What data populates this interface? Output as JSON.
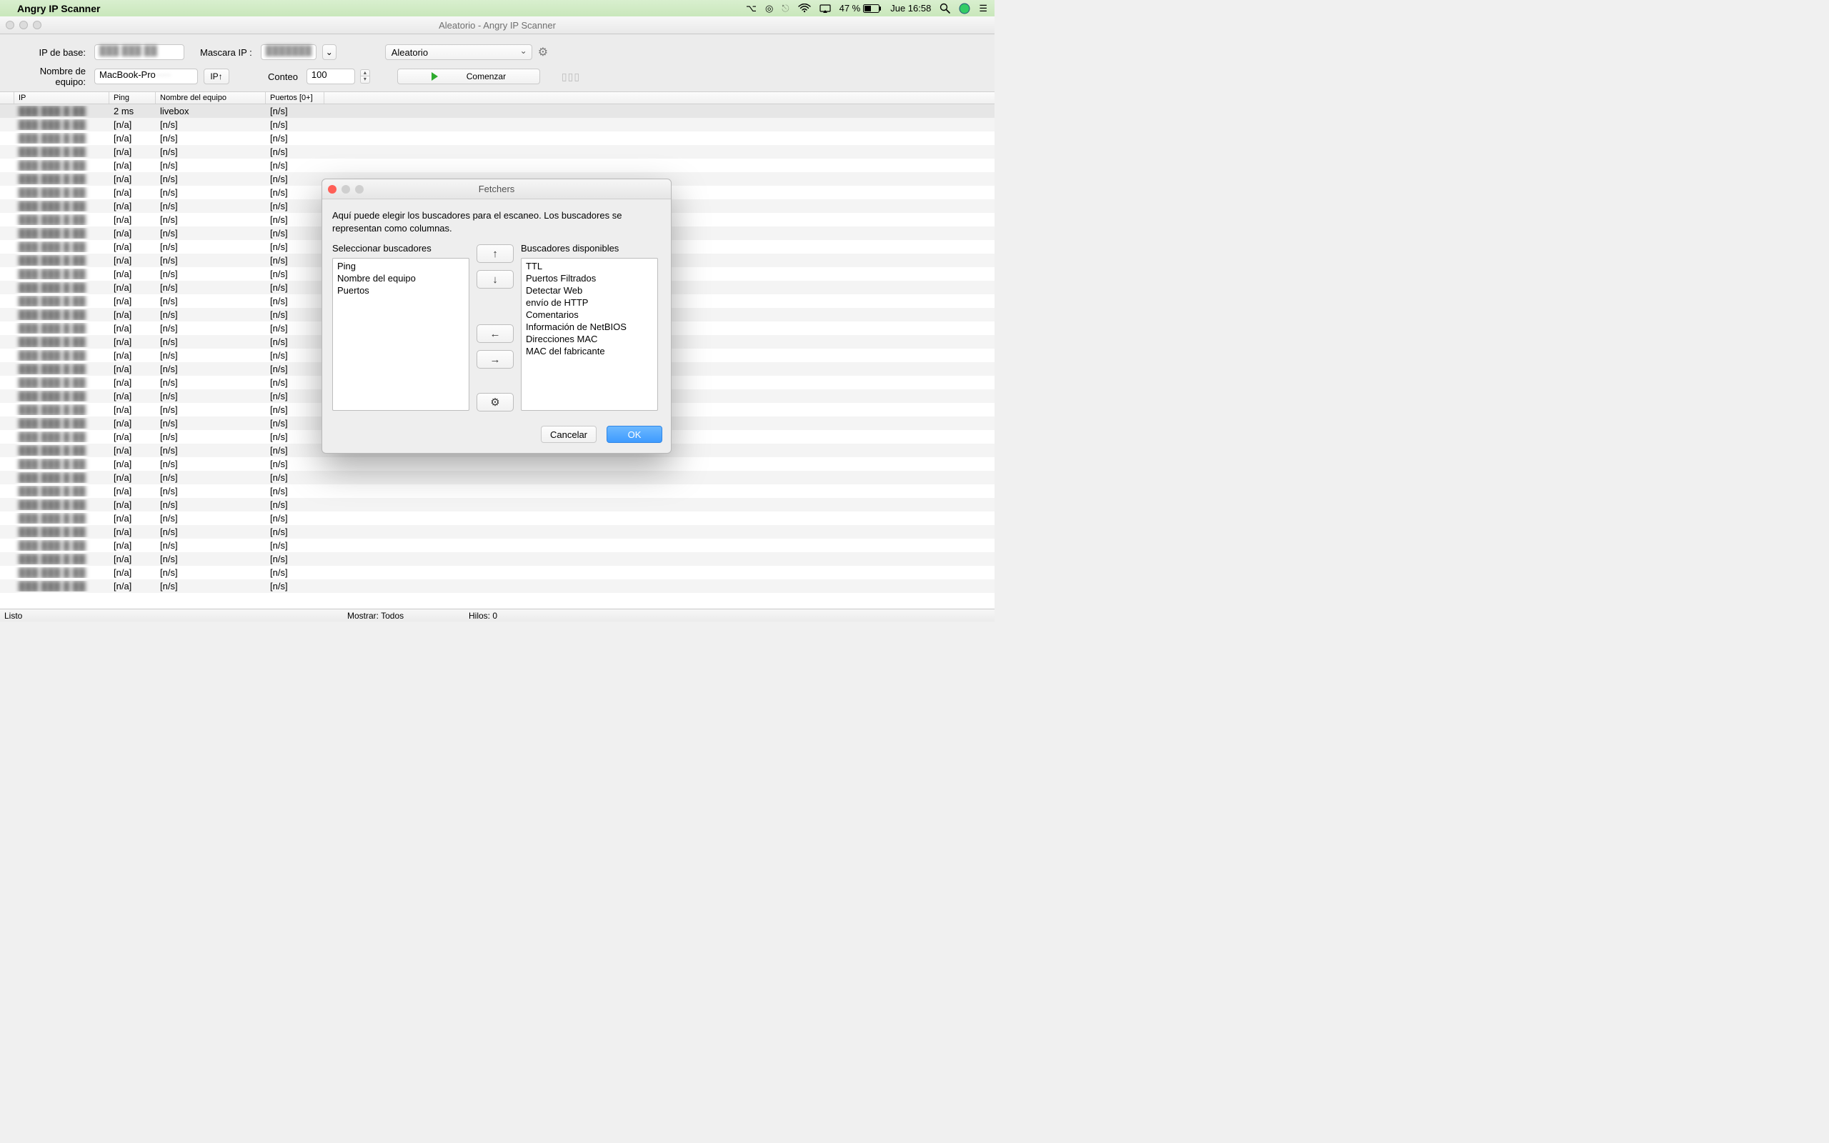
{
  "menubar": {
    "app_name": "Angry IP Scanner",
    "battery": "47 %",
    "clock": "Jue 16:58"
  },
  "window": {
    "title": "Aleatorio - Angry IP Scanner"
  },
  "toolbar": {
    "ip_base_label": "IP de base:",
    "ip_base_value": "███ ███ ██",
    "mask_label": "Mascara IP :",
    "mask_value": "███████",
    "mask_dropdown": "⌄",
    "mode": "Aleatorio",
    "hostname_label": "Nombre de equipo:",
    "hostname_value": "MacBook-Pro",
    "ipup_button": "IP↑",
    "count_label": "Conteo",
    "count_value": "100",
    "start_button": "Comenzar"
  },
  "table": {
    "headers": {
      "ip": "IP",
      "ping": "Ping",
      "host": "Nombre del equipo",
      "ports": "Puertos [0+]"
    },
    "first_row": {
      "ping": "2 ms",
      "host": "livebox",
      "ports": "[n/s]"
    },
    "na": "[n/a]",
    "ns": "[n/s]",
    "row_count": 36
  },
  "statusbar": {
    "ready": "Listo",
    "show": "Mostrar: Todos",
    "threads": "Hilos: 0"
  },
  "dialog": {
    "title": "Fetchers",
    "description": "Aquí puede elegir los buscadores para el escaneo. Los buscadores se representan como columnas.",
    "left_label": "Seleccionar buscadores",
    "right_label": "Buscadores disponibles",
    "selected": [
      "Ping",
      "Nombre del equipo",
      "Puertos"
    ],
    "available": [
      "TTL",
      "Puertos Filtrados",
      "Detectar Web",
      "envío de HTTP",
      "Comentarios",
      "Información de NetBIOS",
      "Direcciones MAC",
      "MAC del fabricante"
    ],
    "arrows": {
      "up": "↑",
      "down": "↓",
      "left": "←",
      "right": "→",
      "gear": "⚙"
    },
    "cancel": "Cancelar",
    "ok": "OK"
  }
}
